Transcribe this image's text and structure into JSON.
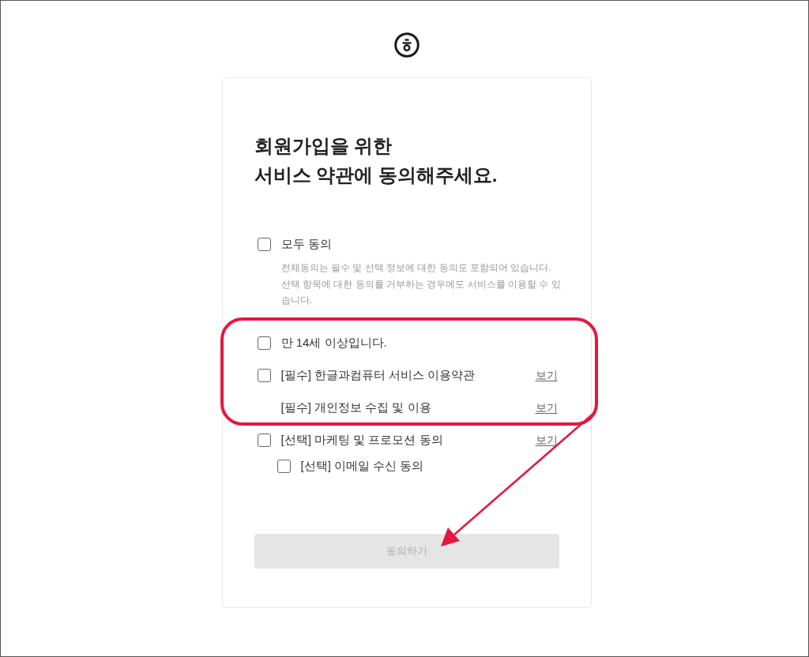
{
  "title": {
    "lines": [
      "회원가입을 위한",
      "서비스 약관에 동의해주세요."
    ]
  },
  "agree_all": {
    "label": "모두 동의",
    "checked": false,
    "note": "전체동의는 필수 및 선택 정보에 대한 동의도 포함되어 있습니다.\n선택 항목에 대한 동의를 거부하는 경우에도 서비스를 이용할 수 있습니다."
  },
  "items": [
    {
      "kind": "checkbox",
      "label": "만 14세 이상입니다.",
      "checked": false
    },
    {
      "kind": "checkbox",
      "label": "[필수] 한글과컴퓨터 서비스 이용약관",
      "checked": false,
      "link": "보기"
    },
    {
      "kind": "plain",
      "label": "[필수] 개인정보 수집 및 이용",
      "link": "보기"
    },
    {
      "kind": "checkbox",
      "label": "[선택] 마케팅 및 프로모션 동의",
      "checked": false,
      "link": "보기",
      "children": [
        {
          "kind": "checkbox",
          "label": "[선택] 이메일 수신 동의",
          "checked": false
        }
      ]
    }
  ],
  "submit_button": {
    "label": "동의하기",
    "disabled": true
  },
  "annotations": {
    "highlight_box": true,
    "arrow": true
  }
}
